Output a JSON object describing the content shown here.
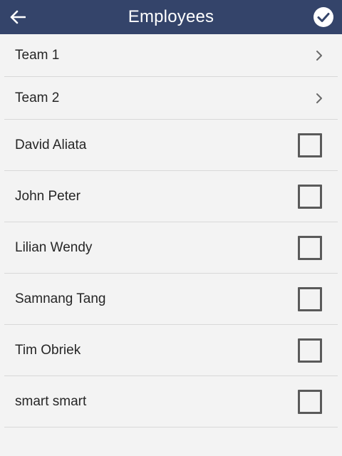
{
  "header": {
    "title": "Employees",
    "back_icon": "arrow-left-icon",
    "confirm_icon": "check-circle-icon",
    "color": "#34446a"
  },
  "teams": [
    {
      "label": "Team 1"
    },
    {
      "label": "Team 2"
    }
  ],
  "employees": [
    {
      "name": "David Aliata",
      "checked": false
    },
    {
      "name": "John Peter",
      "checked": false
    },
    {
      "name": "Lilian Wendy",
      "checked": false
    },
    {
      "name": "Samnang Tang",
      "checked": false
    },
    {
      "name": "Tim Obriek",
      "checked": false
    },
    {
      "name": "smart smart",
      "checked": false
    }
  ]
}
